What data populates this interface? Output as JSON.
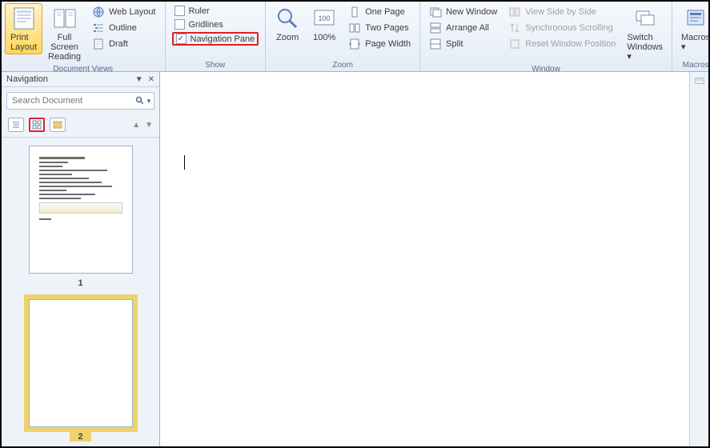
{
  "ribbon": {
    "docviews": {
      "label": "Document Views",
      "print_layout": "Print Layout",
      "full_screen": "Full Screen Reading",
      "web_layout": "Web Layout",
      "outline": "Outline",
      "draft": "Draft"
    },
    "show": {
      "label": "Show",
      "ruler": "Ruler",
      "gridlines": "Gridlines",
      "navpane": "Navigation Pane"
    },
    "zoom": {
      "label": "Zoom",
      "zoom": "Zoom",
      "hundred": "100%",
      "one_page": "One Page",
      "two_pages": "Two Pages",
      "page_width": "Page Width"
    },
    "window": {
      "label": "Window",
      "new_window": "New Window",
      "arrange_all": "Arrange All",
      "split": "Split",
      "side_by_side": "View Side by Side",
      "sync_scroll": "Synchronous Scrolling",
      "reset_pos": "Reset Window Position",
      "switch": "Switch Windows"
    },
    "macros": {
      "label": "Macros",
      "btn": "Macros"
    }
  },
  "nav": {
    "title": "Navigation",
    "search_placeholder": "Search Document",
    "page1": "1",
    "page2": "2"
  }
}
